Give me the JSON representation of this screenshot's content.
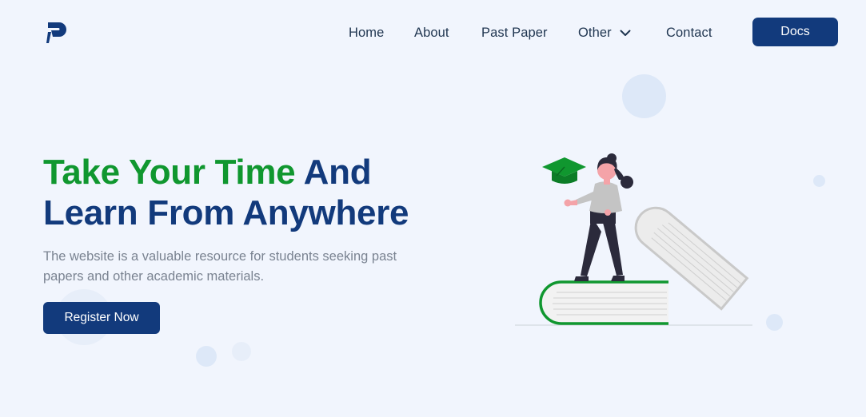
{
  "header": {
    "nav": [
      {
        "name": "nav-home",
        "label": "Home"
      },
      {
        "name": "nav-about",
        "label": "About"
      },
      {
        "name": "nav-past-paper",
        "label": "Past Paper"
      },
      {
        "name": "nav-other",
        "label": "Other"
      },
      {
        "name": "nav-contact",
        "label": "Contact"
      }
    ],
    "docs_label": "Docs"
  },
  "hero": {
    "title_green": "Take Your Time",
    "title_blue_1": "And",
    "title_blue_2": "Learn From Anywhere",
    "description": "The website is a valuable resource for students seeking past papers and other academic materials.",
    "register_label": "Register Now"
  },
  "icons": {
    "logo": "logo-p-icon",
    "dropdown": "chevron-down-icon",
    "illustration": "student-on-books-illustration"
  },
  "colors": {
    "primary": "#123a7c",
    "accent_green": "#10972f",
    "background": "#f1f5fd",
    "text_muted": "#7a8391"
  }
}
